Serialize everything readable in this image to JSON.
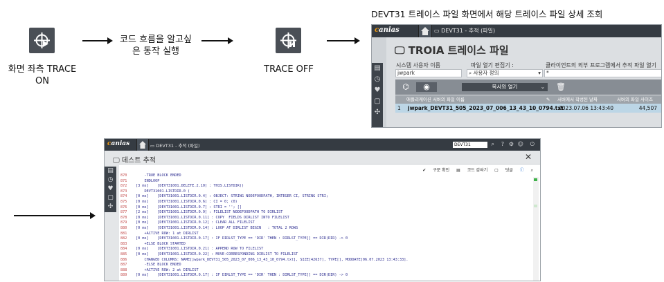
{
  "step1": {
    "caption": "화면 좌측 TRACE ON",
    "caption_line1": "화면 좌측 TRACE",
    "caption_line2": "ON",
    "icon": "trace-on-icon"
  },
  "step2": {
    "caption_line1": "코드 흐름을 알고싶",
    "caption_line2": "은 동작 실행"
  },
  "step3": {
    "caption": "TRACE OFF",
    "icon": "trace-off-icon"
  },
  "step4": {
    "caption": "DEVT31 트레이스 파일 화면에서 해당 트레이스 파일 상세 조회"
  },
  "troia_window": {
    "logo": "canias",
    "tab_label": "DEVT31 - 추적 (파일)",
    "page_title": "TROIA 트레이스 파일",
    "fields": {
      "user_label": "시스템 사용자 이름",
      "user_value": "jwpark",
      "editor_label": "파일 열기 편집기 :",
      "editor_value": "사용자 정의",
      "client_label": "클라이언트의 외부 프로그램에서 추적 파일 열기",
      "client_value": "*"
    },
    "toolbar": {
      "dropdown_label": "복사와 열기"
    },
    "table": {
      "columns": [
        "",
        "애플리케이션 서버의 파일 이름",
        "서버에서 작성된 날짜",
        "서버의 파일 사이즈"
      ],
      "rows": [
        {
          "no": "1",
          "file": "jwpark_DEVT31_505_2023_07_006_13_43_10_0794.txt",
          "date": "2023.07.06 13:43:40",
          "size": "44,507"
        }
      ]
    }
  },
  "trace_window": {
    "logo": "canias",
    "tab_label": "DEVT31 - 추적 (파일)",
    "search_value": "DEVT31",
    "title": "데스트 추적",
    "tools": [
      "구문 확인",
      "코드 감싸기",
      "덧글"
    ],
    "lines": [
      {
        "no": "870",
        "text": "    -TRUE BLOCK ENDED"
      },
      {
        "no": "871",
        "text": "    ENDLOOP"
      },
      {
        "no": "872",
        "text": "[3 ms]    [DEVT31001.DELETE.2.10] : THIS.LISTDIR()"
      },
      {
        "no": "873",
        "text": "    DEVT31001.LISTDIR.0 ("
      },
      {
        "no": "874",
        "text": "[0 ms]    [DEVT31001.LISTDIR.0.4] : OBJECT: STRING NODEFOODPATH, INTEGER CI, STRING STRI;"
      },
      {
        "no": "875",
        "text": "[0 ms]    [DEVT31001.LISTDIR.0.6] : CI = 0; (0)"
      },
      {
        "no": "876",
        "text": "[0 ms]    [DEVT31001.LISTDIR.0.7] : STRI = ''; []"
      },
      {
        "no": "877",
        "text": "[2 ms]    [DEVT31001.LISTDIR.0.9] : FILELIST NODEFOODPATH TO DIRLIST"
      },
      {
        "no": "878",
        "text": "[0 ms]    [DEVT31001.LISTDIR.0.11] : COPY  FIELDS DIRLIST INTO FILELIST"
      },
      {
        "no": "879",
        "text": "[0 ms]    [DEVT31001.LISTDIR.0.12] : CLEAR ALL FILELIST"
      },
      {
        "no": "880",
        "text": "[0 ms]    [DEVT31001.LISTDIR.0.14] : LOOP AT DIRLIST BEGIN   : TOTAL 2 ROWS"
      },
      {
        "no": "881",
        "text": "    +ACTIVE ROW: 1 at DIRLIST"
      },
      {
        "no": "882",
        "text": "[0 ms]    [DEVT31001.LISTDIR.0.17] : IF DIRLST_TYPE == 'DIR' THEN : DIRLST_TYPE[] == DIR(DIR) -> 0"
      },
      {
        "no": "883",
        "text": "    +ELSE BLOCK STARTED"
      },
      {
        "no": "884",
        "text": "[0 ms]    [DEVT31001.LISTDIR.0.21] : APPEND ROW TO FILELIST"
      },
      {
        "no": "885",
        "text": "[0 ms]    [DEVT31001.LISTDIR.0.22] : MOVE-CORRESPONDING DIRLIST TO FILELIST"
      },
      {
        "no": "886",
        "text": "    CHANGED COLUMNS: NAME[jwpark_DEVT31_505_2023_07_006_13_43_10_0794.txt], SIZE[42637], TYPE[], MODDATE[06.07.2023 13:43:33]."
      },
      {
        "no": "887",
        "text": "    -ELSE BLOCK ENDED"
      },
      {
        "no": "888",
        "text": "    +ACTIVE ROW: 2 at DIRLIST"
      },
      {
        "no": "889",
        "text": "[0 ms]    [DEVT31001.LISTDIR.0.17] : IF DIRLST_TYPE == 'DIR' THEN : DIRLST_TYPE[] == DIR(DIR) -> 0"
      }
    ]
  },
  "colors": {
    "titlebar": "#353b42",
    "sidebar": "#3d434a",
    "accent": "#f39c12",
    "selected_row": "#bcd6e6",
    "line_number": "#c24a4a",
    "code_text": "#2b2b8f"
  }
}
